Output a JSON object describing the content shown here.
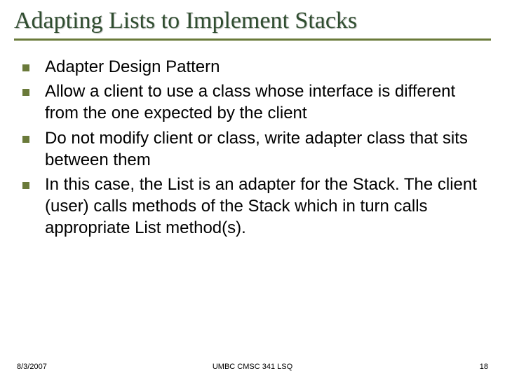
{
  "slide": {
    "title": "Adapting Lists to Implement Stacks",
    "bullets": [
      "Adapter Design Pattern",
      "Allow a client to use a class whose interface is different from the one expected by the client",
      "Do not modify client or class, write adapter class that sits between them",
      "In this case, the List is an adapter for the Stack.  The client (user) calls methods of the Stack which in turn calls appropriate List method(s)."
    ],
    "footer": {
      "date": "8/3/2007",
      "center": "UMBC CMSC 341 LSQ",
      "page": "18"
    },
    "colors": {
      "accent": "#6a7a3a",
      "title": "#2f4d2f"
    }
  }
}
